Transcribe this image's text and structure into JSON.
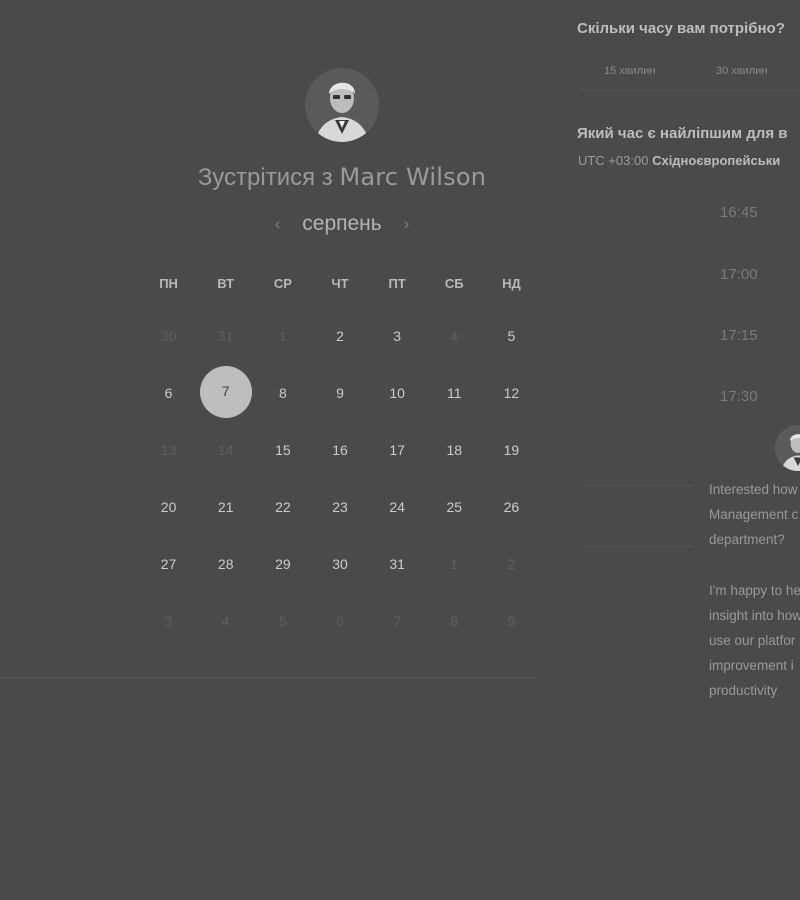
{
  "host": {
    "avatar_icon": "person-avatar-icon",
    "title_prefix": "Зустрітися з",
    "name": "Marc Wilson"
  },
  "calendar": {
    "month": "серпень",
    "weekdays": [
      "ПН",
      "ВТ",
      "СР",
      "ЧТ",
      "ПТ",
      "СБ",
      "НД"
    ],
    "weeks": [
      [
        {
          "d": "30",
          "s": "muted"
        },
        {
          "d": "31",
          "s": "muted"
        },
        {
          "d": "1",
          "s": "muted"
        },
        {
          "d": "2",
          "s": "avail"
        },
        {
          "d": "3",
          "s": "avail"
        },
        {
          "d": "4",
          "s": "muted"
        },
        {
          "d": "5",
          "s": "avail"
        }
      ],
      [
        {
          "d": "6",
          "s": "avail"
        },
        {
          "d": "7",
          "s": "selected"
        },
        {
          "d": "8",
          "s": "avail"
        },
        {
          "d": "9",
          "s": "avail"
        },
        {
          "d": "10",
          "s": "avail"
        },
        {
          "d": "11",
          "s": "avail"
        },
        {
          "d": "12",
          "s": "avail"
        }
      ],
      [
        {
          "d": "13",
          "s": "muted"
        },
        {
          "d": "14",
          "s": "muted"
        },
        {
          "d": "15",
          "s": "avail"
        },
        {
          "d": "16",
          "s": "avail"
        },
        {
          "d": "17",
          "s": "avail"
        },
        {
          "d": "18",
          "s": "avail"
        },
        {
          "d": "19",
          "s": "avail"
        }
      ],
      [
        {
          "d": "20",
          "s": "avail"
        },
        {
          "d": "21",
          "s": "avail"
        },
        {
          "d": "22",
          "s": "avail"
        },
        {
          "d": "23",
          "s": "avail"
        },
        {
          "d": "24",
          "s": "avail"
        },
        {
          "d": "25",
          "s": "avail"
        },
        {
          "d": "26",
          "s": "avail"
        }
      ],
      [
        {
          "d": "27",
          "s": "avail"
        },
        {
          "d": "28",
          "s": "avail"
        },
        {
          "d": "29",
          "s": "avail"
        },
        {
          "d": "30",
          "s": "avail"
        },
        {
          "d": "31",
          "s": "avail"
        },
        {
          "d": "1",
          "s": "muted"
        },
        {
          "d": "2",
          "s": "muted"
        }
      ],
      [
        {
          "d": "3",
          "s": "muted"
        },
        {
          "d": "4",
          "s": "muted"
        },
        {
          "d": "5",
          "s": "muted"
        },
        {
          "d": "6",
          "s": "muted"
        },
        {
          "d": "7",
          "s": "muted"
        },
        {
          "d": "8",
          "s": "muted"
        },
        {
          "d": "9",
          "s": "muted"
        }
      ]
    ]
  },
  "duration": {
    "question": "Скільки часу вам потрібно?",
    "options": [
      "15 хвилин",
      "30 хвилин"
    ]
  },
  "time": {
    "question": "Який час є найліпшим для в",
    "tz_offset": "UTC +03:00",
    "tz_name": "Східноєвропейськи",
    "slots": [
      "16:45",
      "17:00",
      "17:15",
      "17:30"
    ]
  },
  "pitch": {
    "p1": [
      "Interested how",
      "Management c",
      "department?"
    ],
    "p2": [
      "I'm happy to he",
      "insight into how",
      "use our platfor",
      "improvement i",
      "productivity"
    ]
  }
}
